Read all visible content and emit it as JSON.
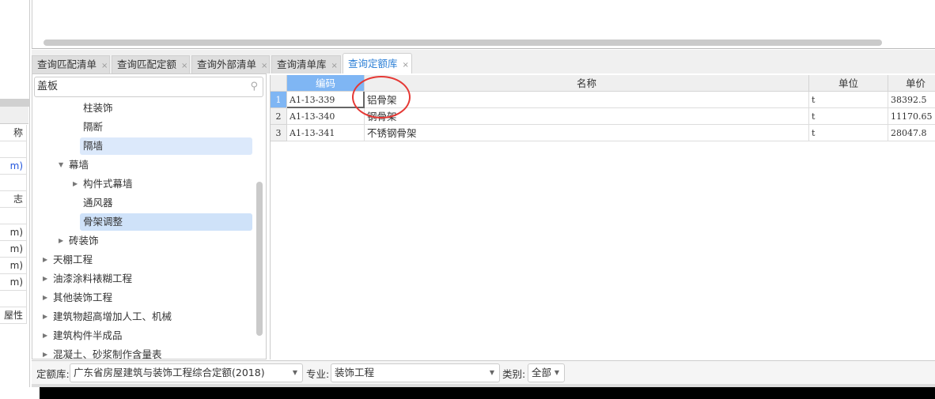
{
  "left_strip": {
    "rows": [
      "称",
      "",
      "m)",
      "",
      "志",
      "",
      "m)",
      "m)",
      "m)",
      "m)",
      "",
      "屋性"
    ]
  },
  "tabs": [
    {
      "label": "查询匹配清单",
      "active": false
    },
    {
      "label": "查询匹配定额",
      "active": false
    },
    {
      "label": "查询外部清单",
      "active": false
    },
    {
      "label": "查询清单库",
      "active": false
    },
    {
      "label": "查询定额库",
      "active": true
    }
  ],
  "close_glyph": "×",
  "search": {
    "value": "盖板",
    "icon": "search-icon"
  },
  "tree": [
    {
      "label": "柱装饰",
      "level": 3,
      "arrow": "",
      "state": ""
    },
    {
      "label": "隔断",
      "level": 3,
      "arrow": "",
      "state": ""
    },
    {
      "label": "隔墙",
      "level": 3,
      "arrow": "",
      "state": "hover"
    },
    {
      "label": "幕墙",
      "level": 2,
      "arrow": "▼",
      "state": ""
    },
    {
      "label": "构件式幕墙",
      "level": 3,
      "arrow": "▶",
      "state": ""
    },
    {
      "label": "通风器",
      "level": 3,
      "arrow": "",
      "state": ""
    },
    {
      "label": "骨架调整",
      "level": 3,
      "arrow": "",
      "state": "selected"
    },
    {
      "label": "砖装饰",
      "level": 2,
      "arrow": "▶",
      "state": ""
    },
    {
      "label": "天棚工程",
      "level": 1,
      "arrow": "▶",
      "state": ""
    },
    {
      "label": "油漆涂料裱糊工程",
      "level": 1,
      "arrow": "▶",
      "state": ""
    },
    {
      "label": "其他装饰工程",
      "level": 1,
      "arrow": "▶",
      "state": ""
    },
    {
      "label": "建筑物超高增加人工、机械",
      "level": 1,
      "arrow": "▶",
      "state": ""
    },
    {
      "label": "建筑构件半成品",
      "level": 1,
      "arrow": "▶",
      "state": ""
    },
    {
      "label": "混凝土、砂浆制作含量表",
      "level": 1,
      "arrow": "▶",
      "state": ""
    }
  ],
  "grid": {
    "columns": [
      "编码",
      "名称",
      "单位",
      "单价"
    ],
    "rows": [
      {
        "num": "1",
        "code": "A1-13-339",
        "name": "铝骨架",
        "unit": "t",
        "price": "38392.5"
      },
      {
        "num": "2",
        "code": "A1-13-340",
        "name": "钢骨架",
        "unit": "t",
        "price": "11170.65"
      },
      {
        "num": "3",
        "code": "A1-13-341",
        "name": "不锈钢骨架",
        "unit": "t",
        "price": "28047.8"
      }
    ]
  },
  "bottom": {
    "library_label": "定额库:",
    "library_value": "广东省房屋建筑与装饰工程综合定额(2018)",
    "specialty_label": "专业:",
    "specialty_value": "装饰工程",
    "category_label": "类别:",
    "category_value": "全部"
  },
  "colors": {
    "accent": "#2b7fd6",
    "header_active": "#7fb6f4",
    "selection": "#cfe2f9",
    "annotation": "#e53935"
  }
}
